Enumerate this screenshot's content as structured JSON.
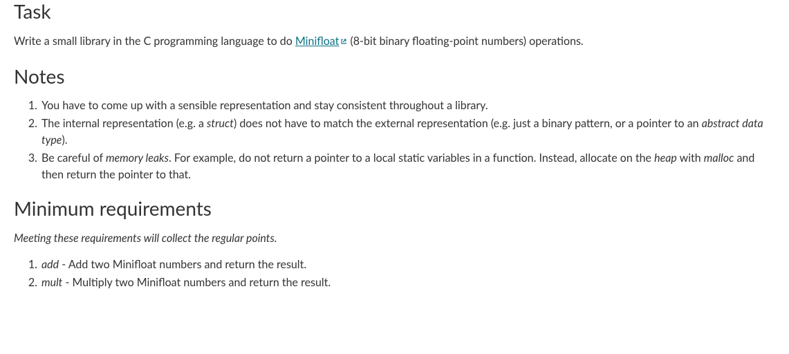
{
  "task": {
    "heading": "Task",
    "intro_prefix": "Write a small library in the C programming language to do ",
    "link_text": "Minifloat",
    "intro_suffix": "  (8-bit binary floating-point numbers) operations."
  },
  "notes": {
    "heading": "Notes",
    "items": [
      {
        "parts": [
          {
            "text": "You have to come up with a sensible representation and stay consistent throughout a library."
          }
        ]
      },
      {
        "parts": [
          {
            "text": "The internal representation (e.g. a "
          },
          {
            "text": "struct",
            "italic": true
          },
          {
            "text": ") does not have to match the external representation (e.g. just a binary pattern, or a pointer to an "
          },
          {
            "text": "abstract data type",
            "italic": true
          },
          {
            "text": ")."
          }
        ]
      },
      {
        "parts": [
          {
            "text": "Be careful of "
          },
          {
            "text": "memory leaks",
            "italic": true
          },
          {
            "text": ". For example, do not return a pointer to a local static variables in a function. Instead, allocate on the "
          },
          {
            "text": "heap",
            "italic": true
          },
          {
            "text": " with "
          },
          {
            "text": "malloc",
            "italic": true
          },
          {
            "text": " and then return the pointer to that."
          }
        ]
      }
    ]
  },
  "minreq": {
    "heading": "Minimum requirements",
    "subnote": "Meeting these requirements will collect the regular points.",
    "items": [
      {
        "parts": [
          {
            "text": "add",
            "italic": true
          },
          {
            "text": " - Add two Minifloat numbers and return the result."
          }
        ]
      },
      {
        "parts": [
          {
            "text": "mult",
            "italic": true
          },
          {
            "text": " - Multiply two Minifloat numbers and return the result."
          }
        ]
      }
    ]
  }
}
